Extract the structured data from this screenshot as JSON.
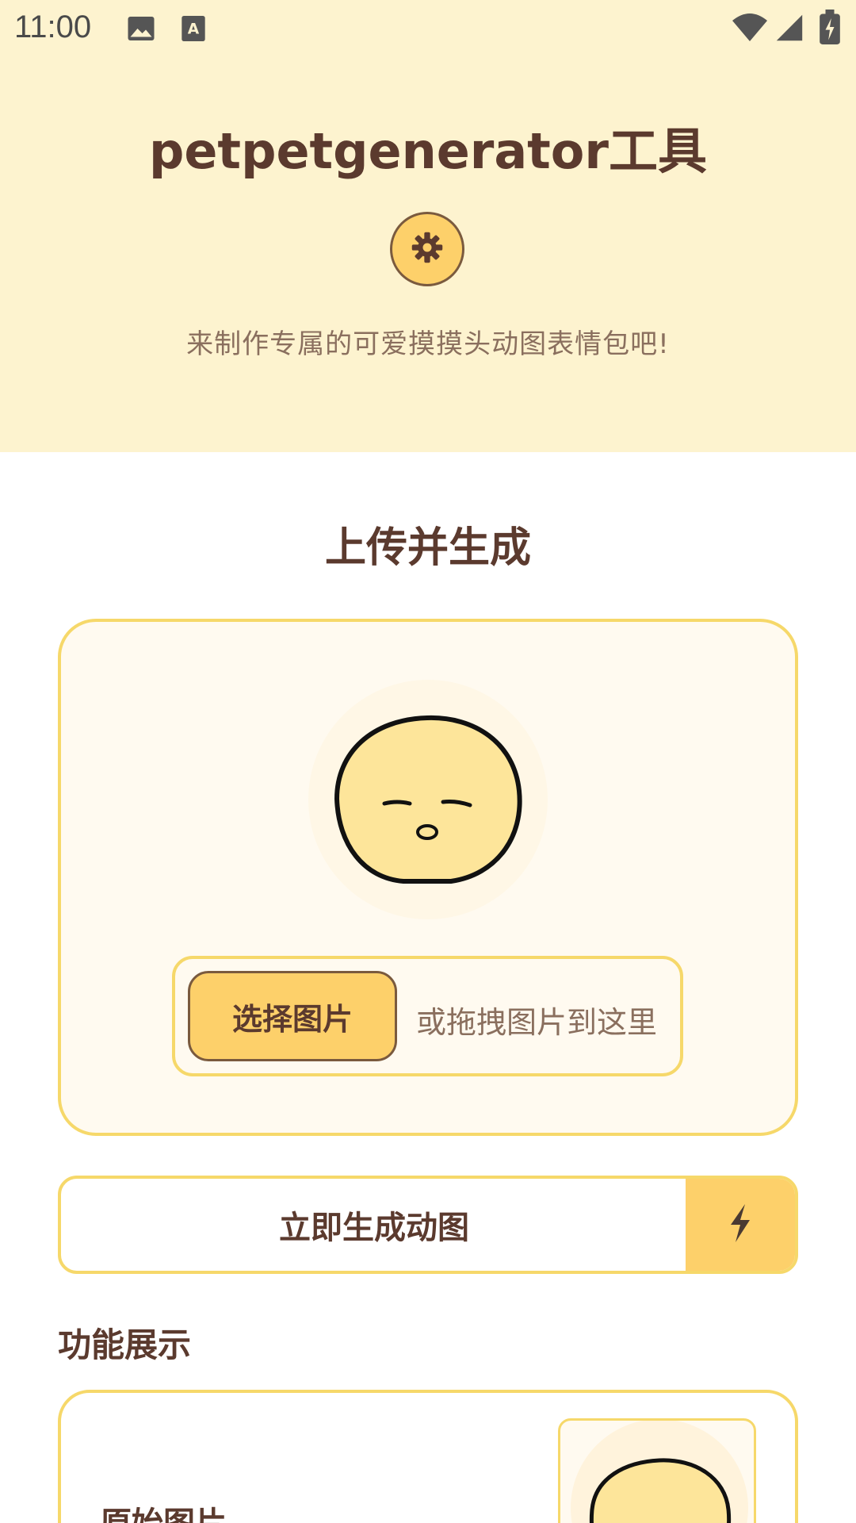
{
  "status_bar": {
    "time": "11:00",
    "left_icons": [
      "image-icon",
      "font-icon"
    ],
    "right_icons": [
      "wifi-icon",
      "signal-icon",
      "battery-charging-icon"
    ]
  },
  "header": {
    "title": "petpetgenerator工具",
    "settings_icon": "gear-icon",
    "tagline": "来制作专属的可爱摸摸头动图表情包吧!"
  },
  "upload": {
    "section_title": "上传并生成",
    "mascot": "sleepy-face",
    "choose_button": "选择图片",
    "drop_hint": "或拖拽图片到这里"
  },
  "generate": {
    "label": "立即生成动图",
    "icon": "lightning-icon"
  },
  "showcase": {
    "title": "功能展示",
    "original_label": "原始图片"
  },
  "colors": {
    "header_bg": "#fdf3cf",
    "accent": "#fdd06a",
    "border": "#f6d86a",
    "text_dark": "#5b3a2e",
    "text_muted": "#8a6f5e"
  }
}
